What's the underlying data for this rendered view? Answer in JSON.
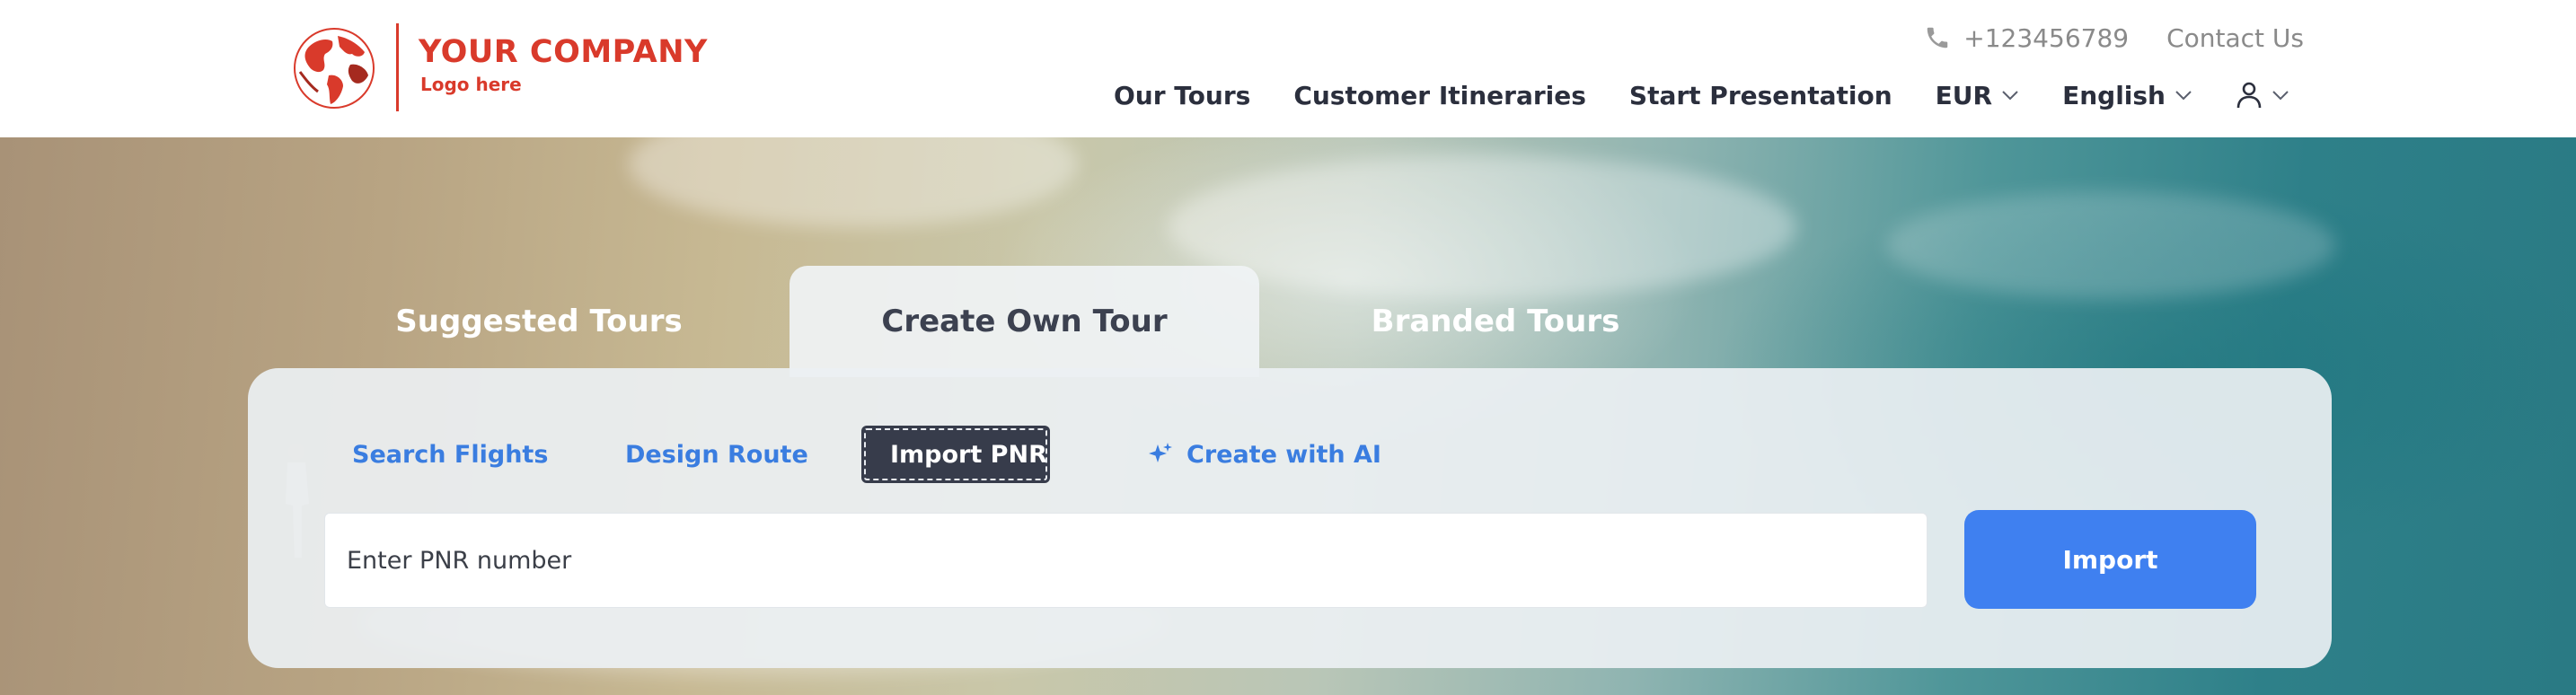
{
  "header": {
    "company": {
      "name": "YOUR COMPANY",
      "tagline": "Logo here"
    },
    "contact": {
      "phone": "+123456789",
      "phone_icon": "phone-icon",
      "contact_link": "Contact Us"
    },
    "nav": {
      "our_tours": "Our Tours",
      "customer_itineraries": "Customer Itineraries",
      "start_presentation": "Start Presentation",
      "currency": "EUR",
      "language": "English",
      "user_icon": "user-icon"
    }
  },
  "tabs": [
    {
      "label": "Suggested Tours",
      "active": false
    },
    {
      "label": "Create Own Tour",
      "active": true
    },
    {
      "label": "Branded Tours",
      "active": false
    }
  ],
  "panel": {
    "subtabs": [
      {
        "label": "Search Flights",
        "active": false
      },
      {
        "label": "Design Route",
        "active": false
      },
      {
        "label": "Import PNR",
        "active": true
      },
      {
        "label": "Create with AI",
        "active": false,
        "icon": "sparkle-icon"
      }
    ],
    "pnr_input": {
      "placeholder": "Enter PNR number",
      "value": ""
    },
    "import_button": "Import"
  },
  "colors": {
    "brand_red": "#d93a2b",
    "accent_blue": "#3f80f0",
    "link_blue": "#3a7de0",
    "active_subtab": "#373c4b",
    "nav_text": "#2b2f3d"
  }
}
